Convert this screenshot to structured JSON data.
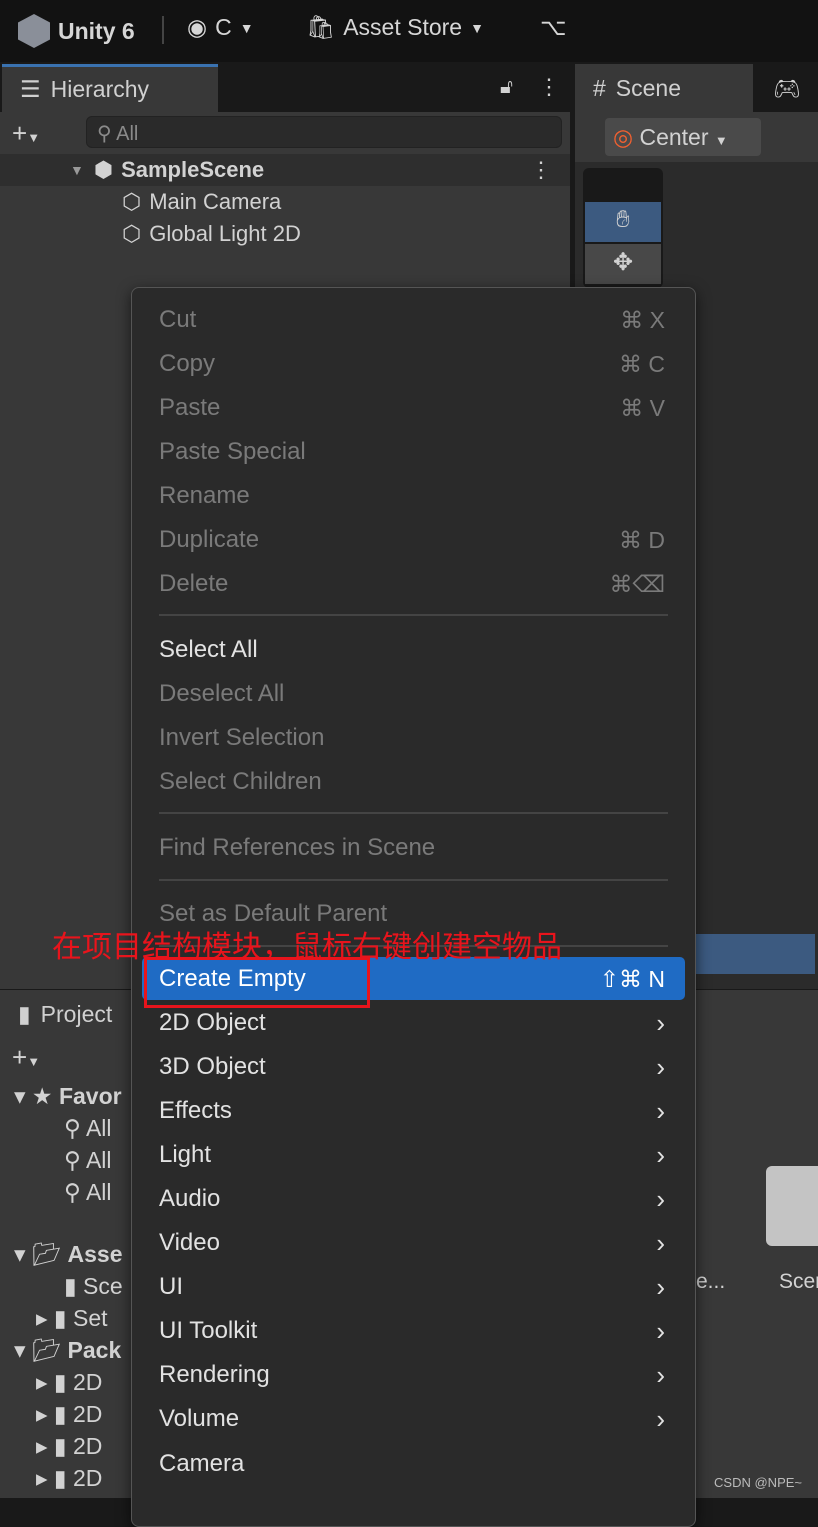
{
  "topbar": {
    "app": "Unity 6",
    "account": "C",
    "asset_store": "Asset Store"
  },
  "hierarchy": {
    "tab": "Hierarchy",
    "search_placeholder": "All",
    "scene": "SampleScene",
    "objects": [
      "Main Camera",
      "Global Light 2D"
    ]
  },
  "scene_panel": {
    "tab": "Scene",
    "pivot": "Center"
  },
  "project": {
    "tab": "Project",
    "tree": [
      "Favor",
      "All",
      "All",
      "All",
      "Asse",
      "Sce",
      "Set",
      "Pack",
      "2D",
      "2D",
      "2D",
      "2D"
    ],
    "thumb_labels": [
      "e...",
      "Scer"
    ]
  },
  "menu": {
    "edit_items": [
      {
        "label": "Cut",
        "shortcut": "⌘ X"
      },
      {
        "label": "Copy",
        "shortcut": "⌘ C"
      },
      {
        "label": "Paste",
        "shortcut": "⌘ V"
      },
      {
        "label": "Paste Special",
        "shortcut": ""
      },
      {
        "label": "Rename",
        "shortcut": ""
      },
      {
        "label": "Duplicate",
        "shortcut": "⌘ D"
      },
      {
        "label": "Delete",
        "shortcut": "⌘⌫"
      }
    ],
    "select_items": [
      "Select All",
      "Deselect All",
      "Invert Selection",
      "Select Children"
    ],
    "find": "Find References in Scene",
    "default_parent": "Set as Default Parent",
    "create_empty": {
      "label": "Create Empty",
      "shortcut": "⇧⌘ N"
    },
    "submenus": [
      "2D Object",
      "3D Object",
      "Effects",
      "Light",
      "Audio",
      "Video",
      "UI",
      "UI Toolkit",
      "Rendering",
      "Volume"
    ],
    "camera": "Camera"
  },
  "annotation": "在项目结构模块，鼠标右键创建空物品",
  "watermark": "CSDN @NPE~",
  "colors": {
    "highlight": "#1f6bc4",
    "annotation": "#e8141c"
  }
}
